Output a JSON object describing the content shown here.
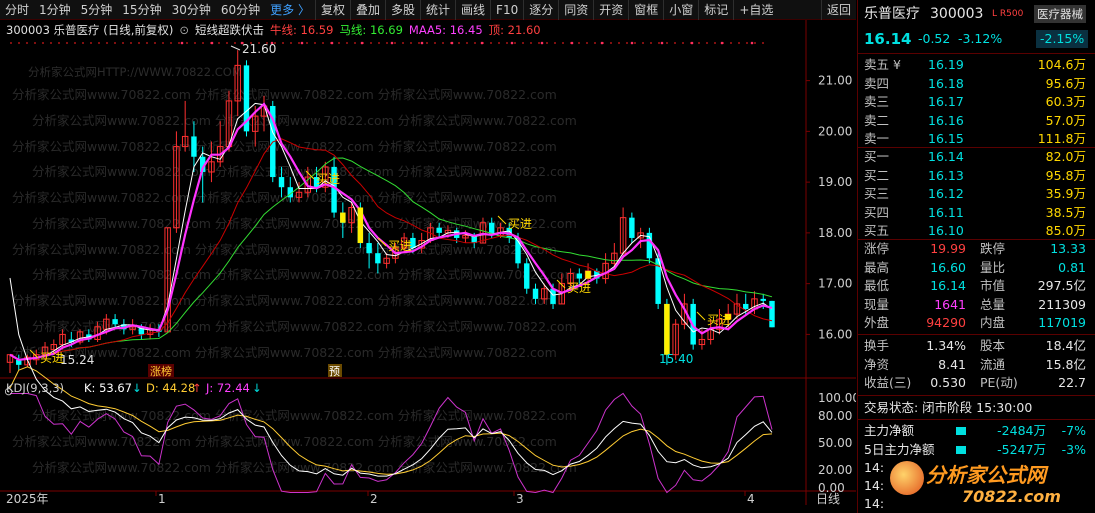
{
  "toolbar": {
    "items": [
      "分时",
      "1分钟",
      "5分钟",
      "15分钟",
      "30分钟",
      "60分钟",
      "更多 〉",
      "复权",
      "叠加",
      "多股",
      "统计",
      "画线",
      "F10",
      "逐分",
      "同资",
      "开资",
      "窗框",
      "小窗",
      "标记",
      "+自选",
      "返回"
    ]
  },
  "header": {
    "code_name": "300003 乐普医疗 (日线,前复权)",
    "indicator": "短线超跌伏击",
    "niu": "牛线: 16.59",
    "ma": "马线: 16.69",
    "maa5": "MAA5: 16.45",
    "top": "顶: 21.60"
  },
  "markers": {
    "high": "21.60",
    "low1": "15.24",
    "low2": "15.40",
    "buy": "买进",
    "zhangbang": "涨榜",
    "yu": "预"
  },
  "kdj": {
    "label": "KDJ(9,3,3)",
    "k": "K: 53.67",
    "d": "D: 44.28",
    "j": "J: 72.44"
  },
  "xaxis": {
    "year": "2025年",
    "months": [
      "1",
      "2",
      "3",
      "4"
    ],
    "period": "日线"
  },
  "yaxis": {
    "price_ticks": [
      "21.00",
      "20.00",
      "19.00",
      "18.00",
      "17.00",
      "16.00"
    ],
    "kdj_ticks": [
      "100.00",
      "80.00",
      "50.00",
      "20.00",
      "0.00"
    ]
  },
  "colors": {
    "up": "#ff3030",
    "down": "#00ffff",
    "ma_white": "#ffffff",
    "ma_red": "#cc0000",
    "ma_green": "#33dd33",
    "ma_magenta": "#ff33ff",
    "kdj_d": "#ffcc33"
  },
  "watermark": "分析家公式网www.70822.com",
  "watermark_url": "分析家公式网HTTP://WWW.70822.COM",
  "logo": {
    "name": "分析家公式网",
    "url": "70822.com"
  },
  "quote": {
    "name": "乐普医疗",
    "code": "300003",
    "flags": "L R500",
    "sector": "医疗器械",
    "price": "16.14",
    "change": "-0.52",
    "pct": "-3.12%",
    "sector_pct": "-2.15%",
    "sells": [
      {
        "label": "卖五 ¥",
        "price": "16.19",
        "vol": "104.6万"
      },
      {
        "label": "卖四",
        "price": "16.18",
        "vol": "95.6万"
      },
      {
        "label": "卖三",
        "price": "16.17",
        "vol": "60.3万"
      },
      {
        "label": "卖二",
        "price": "16.16",
        "vol": "57.0万"
      },
      {
        "label": "卖一",
        "price": "16.15",
        "vol": "111.8万"
      }
    ],
    "buys": [
      {
        "label": "买一",
        "price": "16.14",
        "vol": "82.0万"
      },
      {
        "label": "买二",
        "price": "16.13",
        "vol": "95.8万"
      },
      {
        "label": "买三",
        "price": "16.12",
        "vol": "35.9万"
      },
      {
        "label": "买四",
        "price": "16.11",
        "vol": "38.5万"
      },
      {
        "label": "买五",
        "price": "16.10",
        "vol": "85.0万"
      }
    ],
    "stats": [
      {
        "l1": "涨停",
        "v1": "19.99",
        "c1": "red",
        "l2": "跌停",
        "v2": "13.33",
        "c2": "green"
      },
      {
        "l1": "最高",
        "v1": "16.60",
        "c1": "green",
        "l2": "量比",
        "v2": "0.81",
        "c2": "green"
      },
      {
        "l1": "最低",
        "v1": "16.14",
        "c1": "green",
        "l2": "市值",
        "v2": "297.5亿",
        "c2": "white"
      },
      {
        "l1": "现量",
        "v1": "1641",
        "c1": "magenta",
        "l2": "总量",
        "v2": "211309",
        "c2": "white"
      },
      {
        "l1": "外盘",
        "v1": "94290",
        "c1": "red",
        "l2": "内盘",
        "v2": "117019",
        "c2": "green"
      }
    ],
    "fund": [
      {
        "l1": "换手",
        "v1": "1.34%",
        "l2": "股本",
        "v2": "18.4亿"
      },
      {
        "l1": "净资",
        "v1": "8.41",
        "l2": "流通",
        "v2": "15.8亿"
      },
      {
        "l1": "收益(三)",
        "v1": "0.530",
        "l2": "PE(动)",
        "v2": "22.7"
      }
    ],
    "trade_status": "交易状态: 闭市阶段 15:30:00",
    "flows": [
      {
        "label": "主力净额",
        "value": "-2484万",
        "pct": "-7%"
      },
      {
        "label": "5日主力净额",
        "value": "-5247万",
        "pct": "-3%"
      }
    ],
    "tick_rows": [
      "14:",
      "14:",
      "14:"
    ]
  },
  "chart_data": {
    "type": "candlestick",
    "candles": [
      [
        15.45,
        15.6,
        15.3,
        15.24
      ],
      [
        15.5,
        15.4,
        15.6,
        15.3
      ],
      [
        15.4,
        15.55,
        15.6,
        15.35
      ],
      [
        15.5,
        15.6,
        15.7,
        15.4
      ],
      [
        15.6,
        15.75,
        15.85,
        15.5
      ],
      [
        15.7,
        15.8,
        15.9,
        15.6
      ],
      [
        15.8,
        16.0,
        16.1,
        15.7
      ],
      [
        15.9,
        15.85,
        16.05,
        15.75
      ],
      [
        15.85,
        16.05,
        16.1,
        15.8
      ],
      [
        16.0,
        15.9,
        16.1,
        15.85
      ],
      [
        15.9,
        16.15,
        16.25,
        15.85
      ],
      [
        16.1,
        16.3,
        16.4,
        16.0
      ],
      [
        16.3,
        16.2,
        16.4,
        16.1
      ],
      [
        16.2,
        16.1,
        16.3,
        16.0
      ],
      [
        16.1,
        16.15,
        16.3,
        16.0
      ],
      [
        16.15,
        16.0,
        16.2,
        15.9
      ],
      [
        16.0,
        16.1,
        16.2,
        15.9
      ],
      [
        16.1,
        16.05,
        16.2,
        15.95
      ],
      [
        16.05,
        18.1,
        18.1,
        16.05
      ],
      [
        18.1,
        19.7,
        20.0,
        18.0
      ],
      [
        19.7,
        19.9,
        20.6,
        19.6
      ],
      [
        19.9,
        19.5,
        20.2,
        19.2
      ],
      [
        19.5,
        19.2,
        19.7,
        18.6
      ],
      [
        19.2,
        19.4,
        19.8,
        19.0
      ],
      [
        19.4,
        19.7,
        20.2,
        19.3
      ],
      [
        19.7,
        20.6,
        20.8,
        19.6
      ],
      [
        20.6,
        21.3,
        21.6,
        20.3
      ],
      [
        21.3,
        20.0,
        21.4,
        19.9
      ],
      [
        20.0,
        20.3,
        20.5,
        19.7
      ],
      [
        20.3,
        20.5,
        20.7,
        20.0
      ],
      [
        20.5,
        19.1,
        20.6,
        19.0
      ],
      [
        19.1,
        18.9,
        19.3,
        18.7
      ],
      [
        18.9,
        18.7,
        19.1,
        18.6
      ],
      [
        18.7,
        18.8,
        19.0,
        18.6
      ],
      [
        18.8,
        19.1,
        19.3,
        18.7
      ],
      [
        19.1,
        18.9,
        19.3,
        18.8
      ],
      [
        18.9,
        19.3,
        19.4,
        18.8
      ],
      [
        19.3,
        18.4,
        19.5,
        18.3
      ],
      [
        18.4,
        18.2,
        18.6,
        17.9
      ],
      [
        18.2,
        18.5,
        18.6,
        18.0
      ],
      [
        18.5,
        17.8,
        18.6,
        17.7
      ],
      [
        17.8,
        17.6,
        18.0,
        17.3
      ],
      [
        17.6,
        17.4,
        17.8,
        17.2
      ],
      [
        17.4,
        17.5,
        17.6,
        17.3
      ],
      [
        17.5,
        17.7,
        17.8,
        17.4
      ],
      [
        17.7,
        17.9,
        18.0,
        17.6
      ],
      [
        17.9,
        17.7,
        18.0,
        17.6
      ],
      [
        17.7,
        17.85,
        18.0,
        17.6
      ],
      [
        17.85,
        18.1,
        18.2,
        17.8
      ],
      [
        18.1,
        18.0,
        18.2,
        17.9
      ],
      [
        18.0,
        18.05,
        18.15,
        17.9
      ],
      [
        18.05,
        17.9,
        18.1,
        17.8
      ],
      [
        17.9,
        17.95,
        18.05,
        17.8
      ],
      [
        17.95,
        17.8,
        18.0,
        17.7
      ],
      [
        17.8,
        18.2,
        18.3,
        17.8
      ],
      [
        18.2,
        17.95,
        18.3,
        17.9
      ],
      [
        17.95,
        18.1,
        18.2,
        17.9
      ],
      [
        18.1,
        17.9,
        18.2,
        17.8
      ],
      [
        17.9,
        17.4,
        18.0,
        17.3
      ],
      [
        17.4,
        16.9,
        17.5,
        16.8
      ],
      [
        16.9,
        16.7,
        17.0,
        16.6
      ],
      [
        16.7,
        16.9,
        17.0,
        16.6
      ],
      [
        16.9,
        16.6,
        17.0,
        16.5
      ],
      [
        16.6,
        17.0,
        17.2,
        16.6
      ],
      [
        17.0,
        17.2,
        17.3,
        16.9
      ],
      [
        17.2,
        17.1,
        17.3,
        17.0
      ],
      [
        17.1,
        17.25,
        17.4,
        17.0
      ],
      [
        17.25,
        17.1,
        17.3,
        17.0
      ],
      [
        17.1,
        17.4,
        17.6,
        17.0
      ],
      [
        17.4,
        17.6,
        17.8,
        17.3
      ],
      [
        17.6,
        18.3,
        18.5,
        17.5
      ],
      [
        18.3,
        17.9,
        18.4,
        17.8
      ],
      [
        17.9,
        18.0,
        18.1,
        17.7
      ],
      [
        18.0,
        17.5,
        18.1,
        17.4
      ],
      [
        17.5,
        16.6,
        17.6,
        16.5
      ],
      [
        16.6,
        15.6,
        16.7,
        15.4
      ],
      [
        15.6,
        16.2,
        16.3,
        15.5
      ],
      [
        16.2,
        16.6,
        16.8,
        16.1
      ],
      [
        16.6,
        15.8,
        16.7,
        15.7
      ],
      [
        15.8,
        15.9,
        16.1,
        15.7
      ],
      [
        15.9,
        16.1,
        16.3,
        15.8
      ],
      [
        16.1,
        16.3,
        16.5,
        16.0
      ],
      [
        16.3,
        16.4,
        16.6,
        16.1
      ],
      [
        16.4,
        16.6,
        16.8,
        16.3
      ],
      [
        16.6,
        16.5,
        16.8,
        16.4
      ],
      [
        16.5,
        16.7,
        16.85,
        16.4
      ],
      [
        16.7,
        16.66,
        16.8,
        16.5
      ],
      [
        16.66,
        16.14,
        16.6,
        16.14
      ]
    ],
    "y_range": [
      15.2,
      21.8
    ],
    "kdj_range": [
      0,
      100
    ],
    "last": {
      "k": 53.67,
      "d": 44.28,
      "j": 72.44
    }
  }
}
